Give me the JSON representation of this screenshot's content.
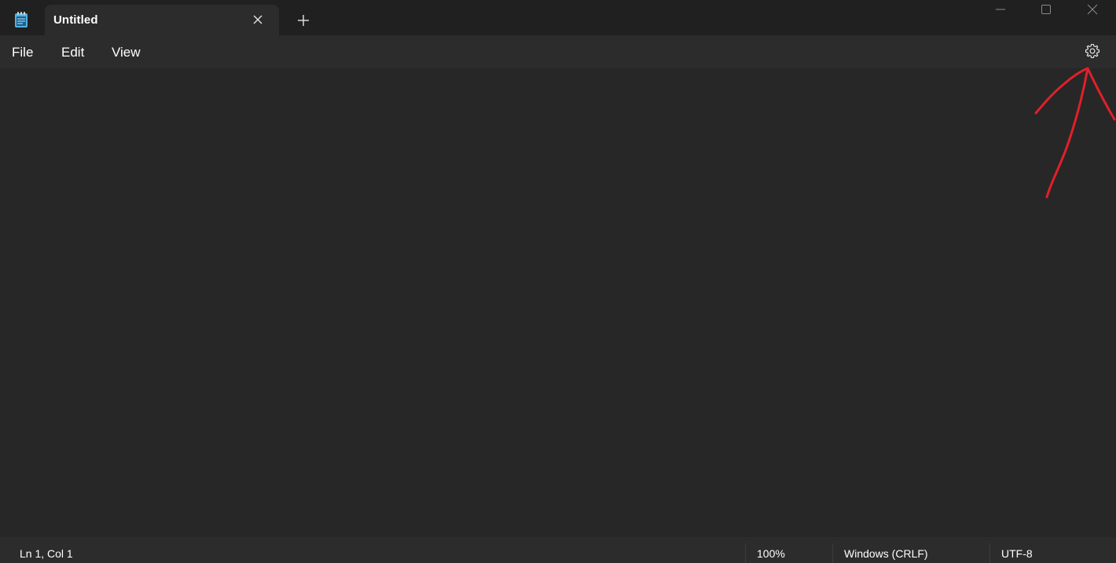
{
  "tab": {
    "title": "Untitled",
    "close_icon": "close-icon"
  },
  "titlebar": {
    "new_tab_icon": "plus-icon",
    "minimize_icon": "minimize-icon",
    "maximize_icon": "maximize-icon",
    "close_icon": "close-icon",
    "app_icon": "notepad-icon"
  },
  "menu": {
    "file": "File",
    "edit": "Edit",
    "view": "View",
    "settings_icon": "gear-icon"
  },
  "editor": {
    "content": ""
  },
  "status": {
    "position": "Ln 1, Col 1",
    "zoom": "100%",
    "line_ending": "Windows (CRLF)",
    "encoding": "UTF-8"
  },
  "annotation": {
    "color": "#e0202a",
    "icon": "arrow-up-icon"
  },
  "colors": {
    "titlebar_bg": "#202020",
    "surface_bg": "#2c2c2c",
    "editor_bg": "#272727",
    "app_icon_accent": "#4fb3e8"
  }
}
